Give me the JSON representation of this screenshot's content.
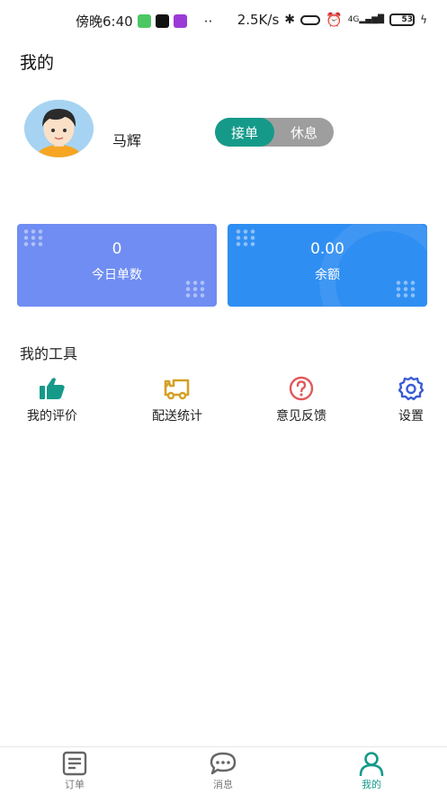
{
  "status_bar": {
    "time": "傍晚6:40",
    "network_speed": "2.5K/s",
    "signal": "4G",
    "battery": "53"
  },
  "header": {
    "title": "我的"
  },
  "profile": {
    "name": "马辉",
    "toggle": {
      "on_label": "接单",
      "off_label": "休息",
      "selected": "接单"
    }
  },
  "stats": [
    {
      "value": "0",
      "label": "今日单数"
    },
    {
      "value": "0.00",
      "label": "余额"
    }
  ],
  "tools": {
    "title": "我的工具",
    "items": [
      {
        "label": "我的评价",
        "icon": "thumbs-up-icon",
        "color": "#159a8a"
      },
      {
        "label": "配送统计",
        "icon": "truck-icon",
        "color": "#d4a024"
      },
      {
        "label": "意见反馈",
        "icon": "question-icon",
        "color": "#e05a5a"
      },
      {
        "label": "设置",
        "icon": "gear-icon",
        "color": "#3b5bd6"
      }
    ]
  },
  "bottom_nav": {
    "items": [
      {
        "label": "订单",
        "icon": "order-icon"
      },
      {
        "label": "消息",
        "icon": "message-icon"
      },
      {
        "label": "我的",
        "icon": "user-icon"
      }
    ],
    "active": "我的",
    "active_color": "#159a8a"
  }
}
